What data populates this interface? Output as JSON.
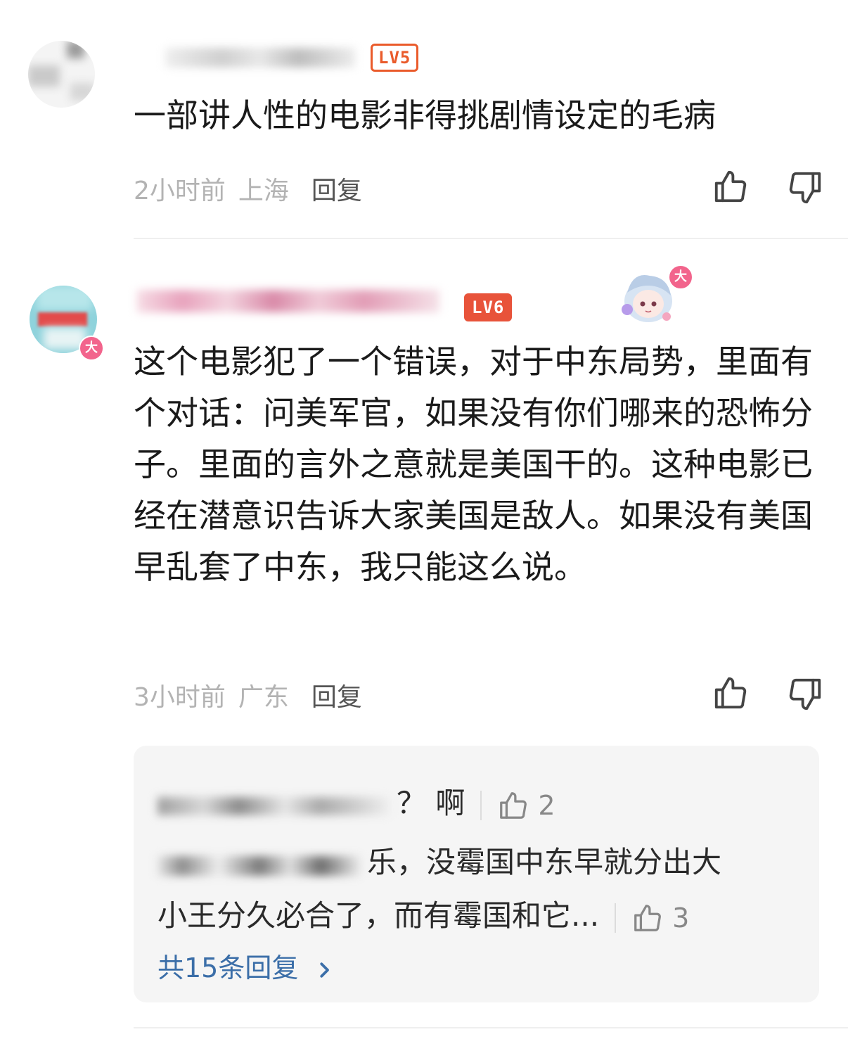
{
  "comments": [
    {
      "level": "LV5",
      "text": "一部讲人性的电影非得挑剧情设定的毛病",
      "time": "2小时前",
      "location": "上海",
      "reply_label": "回复"
    },
    {
      "level": "LV6",
      "avatar_badge": "大",
      "sticker_badge": "大",
      "text": "这个电影犯了一个错误，对于中东局势，里面有个对话：问美军官，如果没有你们哪来的恐怖分子。里面的言外之意就是美国干的。这种电影已经在潜意识告诉大家美国是敌人。如果没有美国 早乱套了中东，我只能这么说。",
      "time": "3小时前",
      "location": "广东",
      "reply_label": "回复"
    }
  ],
  "replies": [
    {
      "text": "？ 啊",
      "likes": "2"
    },
    {
      "text_line1": "乐，没霉国中东早就分出大",
      "text_line2": "小王分久必合了，而有霉国和它...",
      "likes": "3"
    }
  ],
  "more_replies_label": "共15条回复",
  "icons": {
    "like": "thumbs-up-icon",
    "dislike": "thumbs-down-icon",
    "more_arrow": "chevron-right-icon"
  },
  "colors": {
    "level_badge": "#ea5b2b",
    "link": "#3b6ea8",
    "meta_text": "#b3b3b3"
  }
}
